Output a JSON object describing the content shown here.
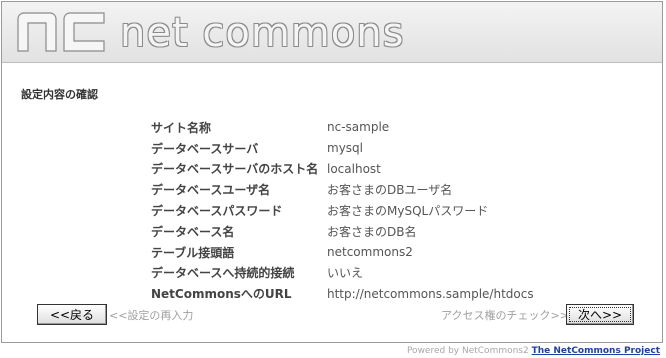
{
  "header": {
    "logo_text": "net commons"
  },
  "section_title": "設定内容の確認",
  "settings": [
    {
      "label": "サイト名称",
      "value": "nc-sample"
    },
    {
      "label": "データベースサーバ",
      "value": "mysql"
    },
    {
      "label": "データベースサーバのホスト名",
      "value": "localhost"
    },
    {
      "label": "データベースユーザ名",
      "value": "お客さまのDBユーザ名"
    },
    {
      "label": "データベースパスワード",
      "value": "お客さまのMySQLパスワード"
    },
    {
      "label": "データベース名",
      "value": "お客さまのDB名"
    },
    {
      "label": "テーブル接頭語",
      "value": "netcommons2"
    },
    {
      "label": "データベースへ持続的接続",
      "value": "いいえ"
    },
    {
      "label": "NetCommonsへのURL",
      "value": "http://netcommons.sample/htdocs"
    }
  ],
  "nav": {
    "back_label": "<<戻る",
    "back_hint": "<<設定の再入力",
    "next_hint": "アクセス権のチェック>>",
    "next_label": "次へ>>"
  },
  "footer": {
    "powered_by": "Powered by NetCommons2",
    "project_link": "The NetCommons Project"
  },
  "colors": {
    "header_bg": "#e8e8e8",
    "link": "#1f3fa8"
  }
}
